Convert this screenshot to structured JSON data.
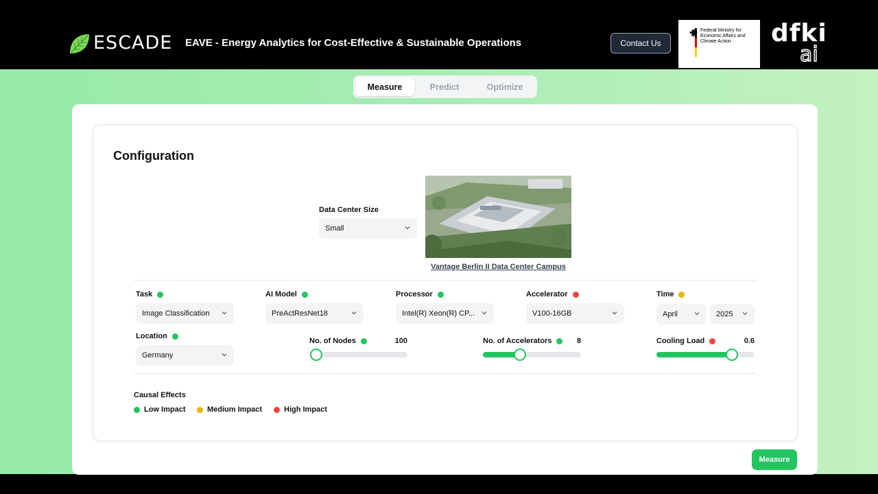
{
  "header": {
    "brand": "ESCADE",
    "title": "EAVE - Energy Analytics for Cost-Effective & Sustainable Operations",
    "contact_label": "Contact Us",
    "ministry_text": "Federal Ministry for Economic Affairs and Climate Action",
    "dfki": "dfki",
    "dfki_ai": "ai",
    "logo_icon": "leaf-logo-icon"
  },
  "tabs": [
    {
      "label": "Measure",
      "active": true
    },
    {
      "label": "Predict",
      "active": false
    },
    {
      "label": "Optimize",
      "active": false
    }
  ],
  "config": {
    "title": "Configuration",
    "data_center": {
      "label": "Data Center Size",
      "value": "Small",
      "image_caption": "Vantage Berlin II Data Center Campus"
    },
    "fields": {
      "task": {
        "label": "Task",
        "value": "Image Classification",
        "impact": "low"
      },
      "ai_model": {
        "label": "AI Model",
        "value": "PreActResNet18",
        "impact": "low"
      },
      "processor": {
        "label": "Processor",
        "value": "Intel(R) Xeon(R) CP...",
        "impact": "low"
      },
      "accelerator": {
        "label": "Accelerator",
        "value": "V100-16GB",
        "impact": "high"
      },
      "time": {
        "label": "Time",
        "month": "April",
        "year": "2025",
        "impact": "medium"
      },
      "location": {
        "label": "Location",
        "value": "Germany",
        "impact": "low"
      }
    },
    "sliders": {
      "nodes": {
        "label": "No. of Nodes",
        "value": "100",
        "fraction": 0.06,
        "impact": "low"
      },
      "accelerators": {
        "label": "No. of Accelerators",
        "value": "8",
        "fraction": 0.38,
        "impact": "low"
      },
      "cooling": {
        "label": "Cooling Load",
        "value": "0.6",
        "fraction": 0.77,
        "impact": "high"
      }
    }
  },
  "legend": {
    "title": "Causal Effects",
    "items": [
      {
        "label": "Low Impact",
        "color": "#22c55e"
      },
      {
        "label": "Medium Impact",
        "color": "#eab308"
      },
      {
        "label": "High Impact",
        "color": "#ef4444"
      }
    ]
  },
  "actions": {
    "measure_label": "Measure"
  },
  "colors": {
    "accent": "#22c55e",
    "medium": "#eab308",
    "high": "#ef4444"
  }
}
